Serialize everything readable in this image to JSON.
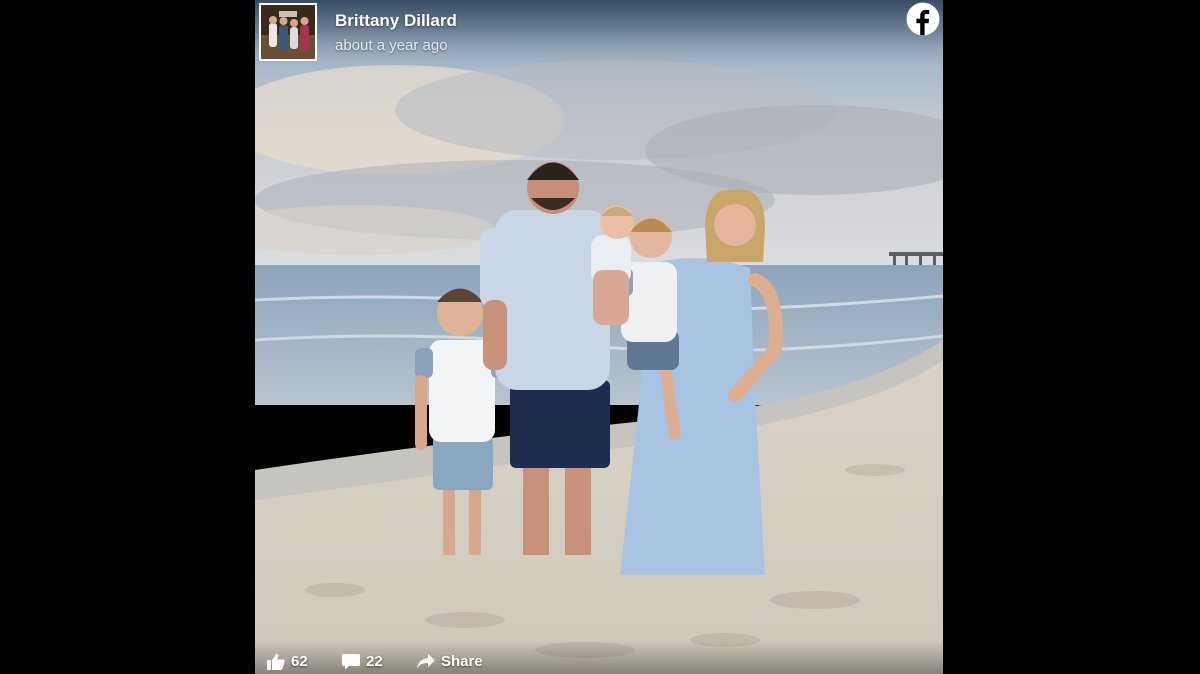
{
  "post": {
    "author": "Brittany Dillard",
    "timestamp": "about a year ago",
    "network_icon": "facebook-icon"
  },
  "actions": {
    "likes": "62",
    "comments": "22",
    "share_label": "Share"
  },
  "colors": {
    "backdrop": "#000000",
    "text": "#ffffff"
  }
}
